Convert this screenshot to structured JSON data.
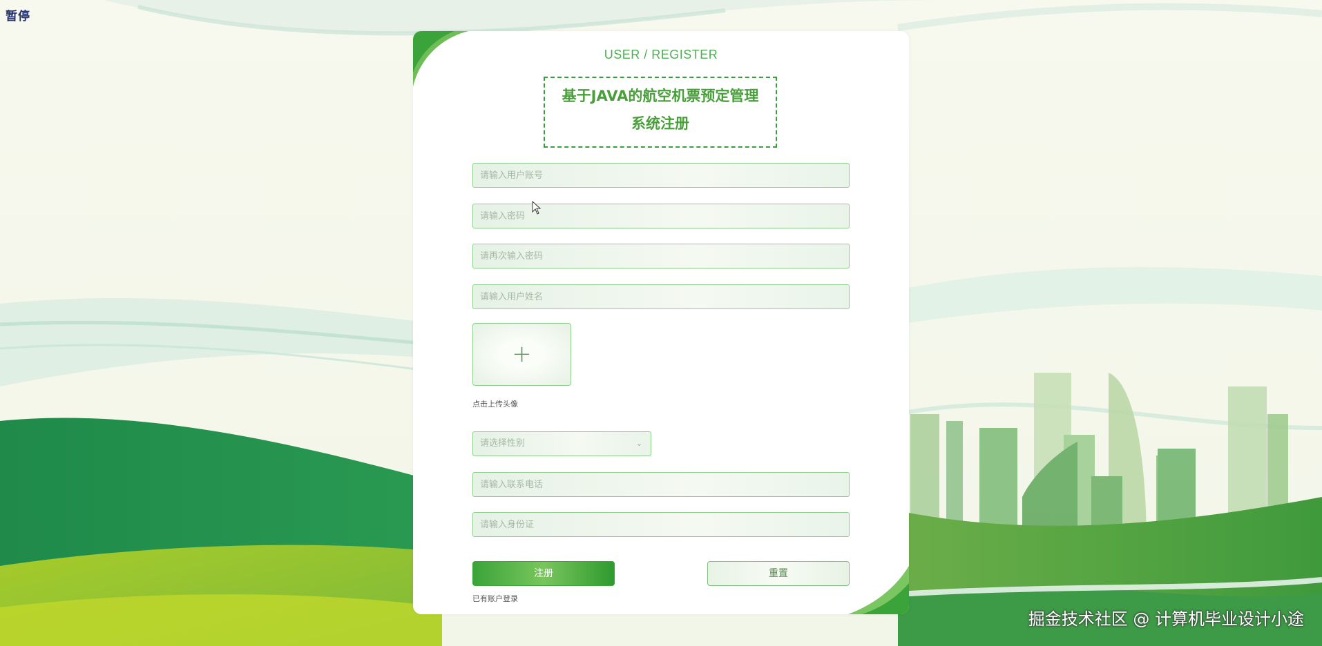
{
  "overlay": {
    "pause_label": "暂停",
    "watermark": "掘金技术社区 @ 计算机毕业设计小途"
  },
  "form": {
    "subtitle": "USER / REGISTER",
    "title_line1": "基于JAVA的航空机票预定管理",
    "title_line2": "系统注册",
    "account_placeholder": "请输入用户账号",
    "password_placeholder": "请输入密码",
    "password_confirm_placeholder": "请再次输入密码",
    "name_placeholder": "请输入用户姓名",
    "avatar_upload_hint": "点击上传头像",
    "gender_placeholder": "请选择性别",
    "phone_placeholder": "请输入联系电话",
    "idcard_placeholder": "请输入身份证",
    "register_label": "注册",
    "reset_label": "重置",
    "login_link": "已有账户登录"
  },
  "icons": {
    "upload": "plus-icon",
    "select": "chevron-down-icon"
  },
  "colors": {
    "accent": "#3aa43a",
    "title_text": "#4a9e3c",
    "field_border": "#8ecf8e",
    "background": "#f6f8ee"
  }
}
